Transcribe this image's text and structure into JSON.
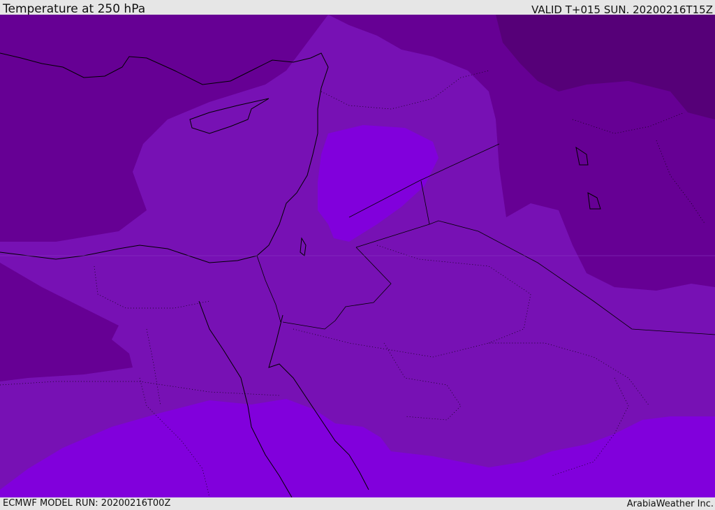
{
  "header": {
    "title": "Temperature at 250 hPa",
    "valid_time": "VALID T+015 SUN. 20200216T15Z"
  },
  "footer": {
    "model_run": "ECMWF MODEL RUN: 20200216T00Z",
    "credit": "ArabiaWeather Inc."
  },
  "map": {
    "region": "Eastern Mediterranean and Middle East",
    "colors": {
      "coldest": "#560078",
      "colder": "#660094",
      "mid": "#7711b4",
      "warmer": "#8100dc",
      "coastline": "#000000"
    }
  }
}
